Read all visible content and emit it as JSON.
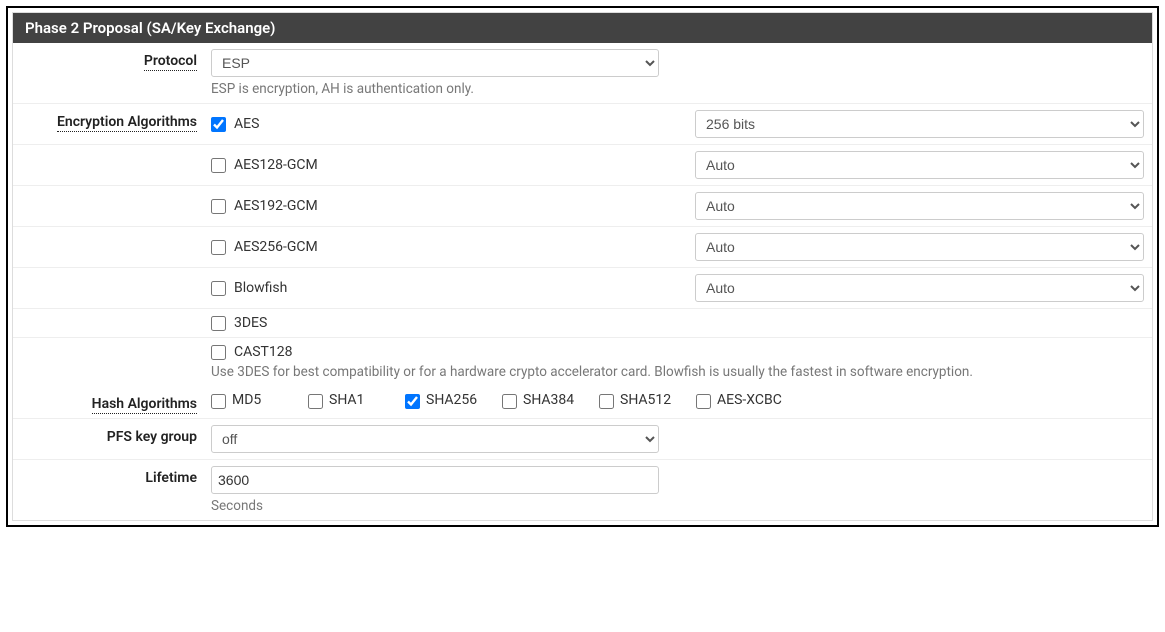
{
  "header": {
    "title": "Phase 2 Proposal (SA/Key Exchange)"
  },
  "protocol": {
    "label": "Protocol",
    "value": "ESP",
    "help": "ESP is encryption, AH is authentication only."
  },
  "encryption": {
    "label": "Encryption Algorithms",
    "algos": [
      {
        "name": "AES",
        "checked": true,
        "bits": "256 bits"
      },
      {
        "name": "AES128-GCM",
        "checked": false,
        "bits": "Auto"
      },
      {
        "name": "AES192-GCM",
        "checked": false,
        "bits": "Auto"
      },
      {
        "name": "AES256-GCM",
        "checked": false,
        "bits": "Auto"
      },
      {
        "name": "Blowfish",
        "checked": false,
        "bits": "Auto"
      },
      {
        "name": "3DES",
        "checked": false,
        "bits": null
      },
      {
        "name": "CAST128",
        "checked": false,
        "bits": null
      }
    ],
    "help": "Use 3DES for best compatibility or for a hardware crypto accelerator card. Blowfish is usually the fastest in software encryption."
  },
  "hash": {
    "label": "Hash Algorithms",
    "algos": [
      {
        "name": "MD5",
        "checked": false
      },
      {
        "name": "SHA1",
        "checked": false
      },
      {
        "name": "SHA256",
        "checked": true
      },
      {
        "name": "SHA384",
        "checked": false
      },
      {
        "name": "SHA512",
        "checked": false
      },
      {
        "name": "AES-XCBC",
        "checked": false
      }
    ]
  },
  "pfs": {
    "label": "PFS key group",
    "value": "off"
  },
  "lifetime": {
    "label": "Lifetime",
    "value": "3600",
    "help": "Seconds"
  }
}
